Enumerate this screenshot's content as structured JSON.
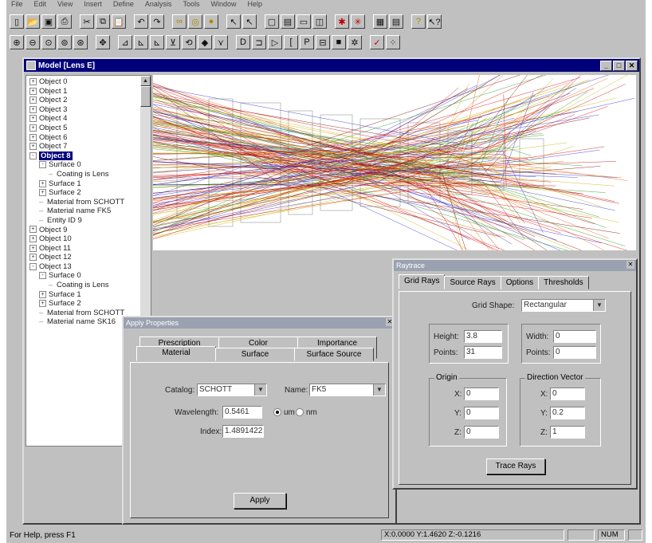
{
  "menu": [
    "File",
    "Edit",
    "View",
    "Insert",
    "Define",
    "Analysis",
    "Tools",
    "Window",
    "Help"
  ],
  "toolbar1": [
    {
      "icon": "new-icon",
      "glyph": "▯"
    },
    {
      "icon": "open-icon",
      "glyph": "📂"
    },
    {
      "icon": "save-icon",
      "glyph": "▣"
    },
    {
      "icon": "print-icon",
      "glyph": "⎙"
    },
    {
      "sep": true
    },
    {
      "icon": "cut-icon",
      "glyph": "✂"
    },
    {
      "icon": "copy-icon",
      "glyph": "⧉"
    },
    {
      "icon": "paste-icon",
      "glyph": "📋"
    },
    {
      "sep": true
    },
    {
      "icon": "undo-icon",
      "glyph": "↶"
    },
    {
      "icon": "redo-icon",
      "glyph": "↷"
    },
    {
      "sep": true
    },
    {
      "icon": "glasses-icon",
      "glyph": "∞",
      "color": "yellow"
    },
    {
      "icon": "lens-yellow-icon",
      "glyph": "◎",
      "color": "yellow"
    },
    {
      "icon": "ball-icon",
      "glyph": "●",
      "color": "yellow"
    },
    {
      "sep": true
    },
    {
      "icon": "arrow-select-icon",
      "glyph": "↖"
    },
    {
      "icon": "arrow-select2-icon",
      "glyph": "↖"
    },
    {
      "sep": true
    },
    {
      "icon": "window-icon",
      "glyph": "▢"
    },
    {
      "icon": "window-split-icon",
      "glyph": "▤"
    },
    {
      "icon": "window-horiz-icon",
      "glyph": "▭"
    },
    {
      "icon": "window-vert-icon",
      "glyph": "◫"
    },
    {
      "sep": true
    },
    {
      "icon": "trace-icon",
      "glyph": "✱",
      "color": "red"
    },
    {
      "icon": "ray-icon",
      "glyph": "✳",
      "color": "red"
    },
    {
      "sep": true
    },
    {
      "icon": "grid-icon",
      "glyph": "▦"
    },
    {
      "icon": "calc-icon",
      "glyph": "▤"
    },
    {
      "sep": true
    },
    {
      "icon": "help-icon",
      "glyph": "?",
      "color": "yellow"
    },
    {
      "icon": "context-help-icon",
      "glyph": "↖?"
    }
  ],
  "toolbar2": [
    {
      "icon": "zoom-in-icon",
      "glyph": "⊕"
    },
    {
      "icon": "zoom-out-icon",
      "glyph": "⊖"
    },
    {
      "icon": "zoom-window-icon",
      "glyph": "⊙"
    },
    {
      "icon": "zoom-all-icon",
      "glyph": "⊚"
    },
    {
      "icon": "zoom-prev-icon",
      "glyph": "⊛"
    },
    {
      "sep": true
    },
    {
      "icon": "pan-icon",
      "glyph": "✥"
    },
    {
      "sep": true
    },
    {
      "icon": "view-xy-icon",
      "glyph": "⊿"
    },
    {
      "icon": "view-yz-icon",
      "glyph": "⊾"
    },
    {
      "icon": "view-xz-icon",
      "glyph": "⊾"
    },
    {
      "icon": "view-iso-icon",
      "glyph": "⊻"
    },
    {
      "icon": "view-rot-icon",
      "glyph": "⟲"
    },
    {
      "icon": "view-tilt-icon",
      "glyph": "◆"
    },
    {
      "icon": "view-ray-icon",
      "glyph": "⋎"
    },
    {
      "sep": true
    },
    {
      "icon": "lens-icon",
      "glyph": "D"
    },
    {
      "icon": "mirror-icon",
      "glyph": "⊐"
    },
    {
      "icon": "prism-icon",
      "glyph": "▷"
    },
    {
      "icon": "bracket-icon",
      "glyph": "["
    },
    {
      "icon": "p-icon",
      "glyph": "P"
    },
    {
      "icon": "detector-icon",
      "glyph": "⊟"
    },
    {
      "icon": "block-icon",
      "glyph": "■"
    },
    {
      "icon": "source-icon",
      "glyph": "✲"
    },
    {
      "sep": true
    },
    {
      "icon": "check-icon",
      "glyph": "✓",
      "color": "red"
    },
    {
      "icon": "dots-icon",
      "glyph": "⁘"
    }
  ],
  "model": {
    "title": "Model [Lens E]",
    "tree": [
      {
        "label": "Object 0",
        "indent": 0,
        "exp": "+"
      },
      {
        "label": "Object 1",
        "indent": 0,
        "exp": "+"
      },
      {
        "label": "Object 2",
        "indent": 0,
        "exp": "+"
      },
      {
        "label": "Object 3",
        "indent": 0,
        "exp": "+"
      },
      {
        "label": "Object 4",
        "indent": 0,
        "exp": "+"
      },
      {
        "label": "Object 5",
        "indent": 0,
        "exp": "+"
      },
      {
        "label": "Object 6",
        "indent": 0,
        "exp": "+"
      },
      {
        "label": "Object 7",
        "indent": 0,
        "exp": "+"
      },
      {
        "label": "Object 8",
        "indent": 0,
        "exp": "-",
        "selected": true
      },
      {
        "label": "Surface 0",
        "indent": 1,
        "exp": "-"
      },
      {
        "label": "Coating is Lens",
        "indent": 2
      },
      {
        "label": "Surface 1",
        "indent": 1,
        "exp": "+"
      },
      {
        "label": "Surface 2",
        "indent": 1,
        "exp": "+"
      },
      {
        "label": "Material from SCHOTT",
        "indent": 1
      },
      {
        "label": "Material name FK5",
        "indent": 1
      },
      {
        "label": "Entity ID 9",
        "indent": 1
      },
      {
        "label": "Object 9",
        "indent": 0,
        "exp": "+"
      },
      {
        "label": "Object 10",
        "indent": 0,
        "exp": "+"
      },
      {
        "label": "Object 11",
        "indent": 0,
        "exp": "+"
      },
      {
        "label": "Object 12",
        "indent": 0,
        "exp": "+"
      },
      {
        "label": "Object 13",
        "indent": 0,
        "exp": "-"
      },
      {
        "label": "Surface 0",
        "indent": 1,
        "exp": "-"
      },
      {
        "label": "Coating is Lens",
        "indent": 2
      },
      {
        "label": "Surface 1",
        "indent": 1,
        "exp": "+"
      },
      {
        "label": "Surface 2",
        "indent": 1,
        "exp": "+"
      },
      {
        "label": "Material from SCHOTT",
        "indent": 1
      },
      {
        "label": "Material name SK16",
        "indent": 1
      }
    ]
  },
  "raytrace": {
    "title": "Raytrace",
    "tabs": [
      "Grid Rays",
      "Source Rays",
      "Options",
      "Thresholds"
    ],
    "grid_shape_label": "Grid Shape:",
    "grid_shape_value": "Rectangular",
    "height_label": "Height:",
    "height_value": "3.8",
    "points_label": "Points:",
    "points_value": "31",
    "width_label": "Width:",
    "width_value": "0",
    "points2_label": "Points:",
    "points2_value": "0",
    "origin_title": "Origin",
    "origin": {
      "x_label": "X:",
      "x": "0",
      "y_label": "Y:",
      "y": "0",
      "z_label": "Z:",
      "z": "0"
    },
    "direction_title": "Direction Vector",
    "direction": {
      "x_label": "X:",
      "x": "0",
      "y_label": "Y:",
      "y": "0.2",
      "z_label": "Z:",
      "z": "1"
    },
    "trace_button": "Trace Rays"
  },
  "apply": {
    "title": "Apply Properties",
    "tabs_row1": [
      "Prescription",
      "Color",
      "Importance Sampling"
    ],
    "tabs_row2": [
      "Material",
      "Surface",
      "Surface Source"
    ],
    "catalog_label": "Catalog:",
    "catalog_value": "SCHOTT",
    "name_label": "Name:",
    "name_value": "FK5",
    "wavelength_label": "Wavelength:",
    "wavelength_value": "0.5461",
    "unit_um": "um",
    "unit_nm": "nm",
    "index_label": "Index:",
    "index_value": "1.4891422",
    "apply_button": "Apply"
  },
  "status": {
    "help": "For Help, press F1",
    "coords": "X:0.0000 Y:1.4620 Z:-0.1216",
    "num": "NUM"
  },
  "colors": {
    "title_active": "#00007b",
    "title_inactive": "#9aa1b0",
    "face": "#c0c0c0"
  }
}
